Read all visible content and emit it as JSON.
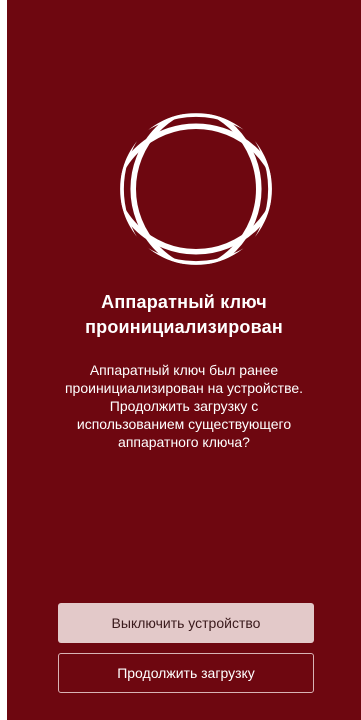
{
  "colors": {
    "background": "#6e0710",
    "primary_button_bg": "#e3c9c9",
    "primary_button_text": "#3a1a1c",
    "secondary_button_border": "#d9b3b5",
    "text": "#ffffff"
  },
  "logo": {
    "icon": "ring-logo-icon"
  },
  "title": {
    "line1": "Аппаратный ключ",
    "line2": "проинициализирован"
  },
  "message": {
    "line1": "Аппаратный ключ был ранее",
    "line2": "проинициализирован на устройстве.",
    "line3": "Продолжить загрузку с",
    "line4": "использованием существующего",
    "line5": "аппаратного ключа?"
  },
  "buttons": {
    "shutdown_label": "Выключить устройство",
    "continue_label": "Продолжить загрузку"
  }
}
